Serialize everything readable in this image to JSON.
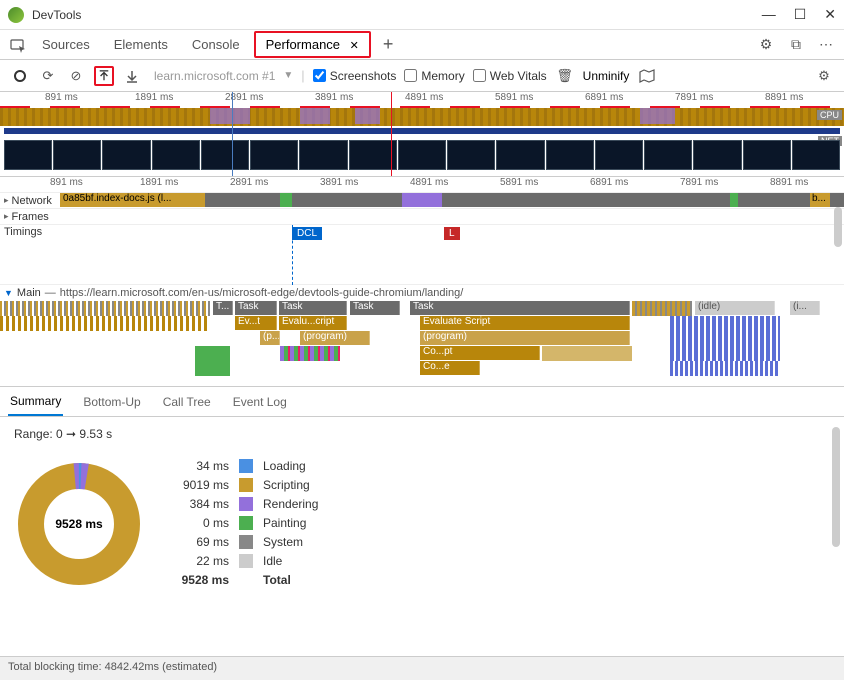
{
  "window": {
    "title": "DevTools"
  },
  "tabs": {
    "items": [
      "Sources",
      "Elements",
      "Console",
      "Performance"
    ],
    "active_index": 3
  },
  "toolbar": {
    "url": "learn.microsoft.com #1",
    "screenshots_label": "Screenshots",
    "memory_label": "Memory",
    "web_vitals_label": "Web Vitals",
    "unminify_label": "Unminify",
    "screenshots_checked": true,
    "memory_checked": false,
    "web_vitals_checked": false
  },
  "overview": {
    "ticks": [
      "891 ms",
      "1891 ms",
      "2891 ms",
      "3891 ms",
      "4891 ms",
      "5891 ms",
      "6891 ms",
      "7891 ms",
      "8891 ms"
    ],
    "cpu_label": "CPU",
    "net_label": "NET"
  },
  "tracks": {
    "network_label": "Network",
    "network_file": "0a85bf.index-docs.js (l...",
    "frames_label": "Frames",
    "timings_label": "Timings",
    "dcl_label": "DCL",
    "load_label": "L",
    "main_label": "Main",
    "main_url": "https://learn.microsoft.com/en-us/microsoft-edge/devtools-guide-chromium/landing/",
    "tasks": {
      "t1": "T...",
      "t2": "Task",
      "t3": "Task",
      "t4": "Task",
      "t5": "Task",
      "idle": "(idle)",
      "idle2": "(i...",
      "ev": "Ev...t",
      "eval": "Evalu...cript",
      "eval2": "Evaluate Script",
      "prog_short": "(p...)",
      "prog": "(program)",
      "prog2": "(program)",
      "co1": "Co...pt",
      "co2": "Co...e"
    }
  },
  "bottom": {
    "tabs": [
      "Summary",
      "Bottom-Up",
      "Call Tree",
      "Event Log"
    ],
    "active_index": 0,
    "range_label": "Range: 0 ➞ 9.53 s",
    "donut_total": "9528 ms",
    "legend": [
      {
        "ms": "34 ms",
        "label": "Loading",
        "color": "#4a90e2"
      },
      {
        "ms": "9019 ms",
        "label": "Scripting",
        "color": "#c89b2e"
      },
      {
        "ms": "384 ms",
        "label": "Rendering",
        "color": "#9370db"
      },
      {
        "ms": "0 ms",
        "label": "Painting",
        "color": "#4caf50"
      },
      {
        "ms": "69 ms",
        "label": "System",
        "color": "#888"
      },
      {
        "ms": "22 ms",
        "label": "Idle",
        "color": "#ccc"
      }
    ],
    "total_ms": "9528 ms",
    "total_label": "Total"
  },
  "status": {
    "text": "Total blocking time: 4842.42ms (estimated)"
  },
  "chart_data": {
    "type": "pie",
    "title": "Summary",
    "series": [
      {
        "name": "Loading",
        "value": 34,
        "color": "#4a90e2"
      },
      {
        "name": "Scripting",
        "value": 9019,
        "color": "#c89b2e"
      },
      {
        "name": "Rendering",
        "value": 384,
        "color": "#9370db"
      },
      {
        "name": "Painting",
        "value": 0,
        "color": "#4caf50"
      },
      {
        "name": "System",
        "value": 69,
        "color": "#888888"
      },
      {
        "name": "Idle",
        "value": 22,
        "color": "#cccccc"
      }
    ],
    "total": 9528,
    "unit": "ms"
  }
}
